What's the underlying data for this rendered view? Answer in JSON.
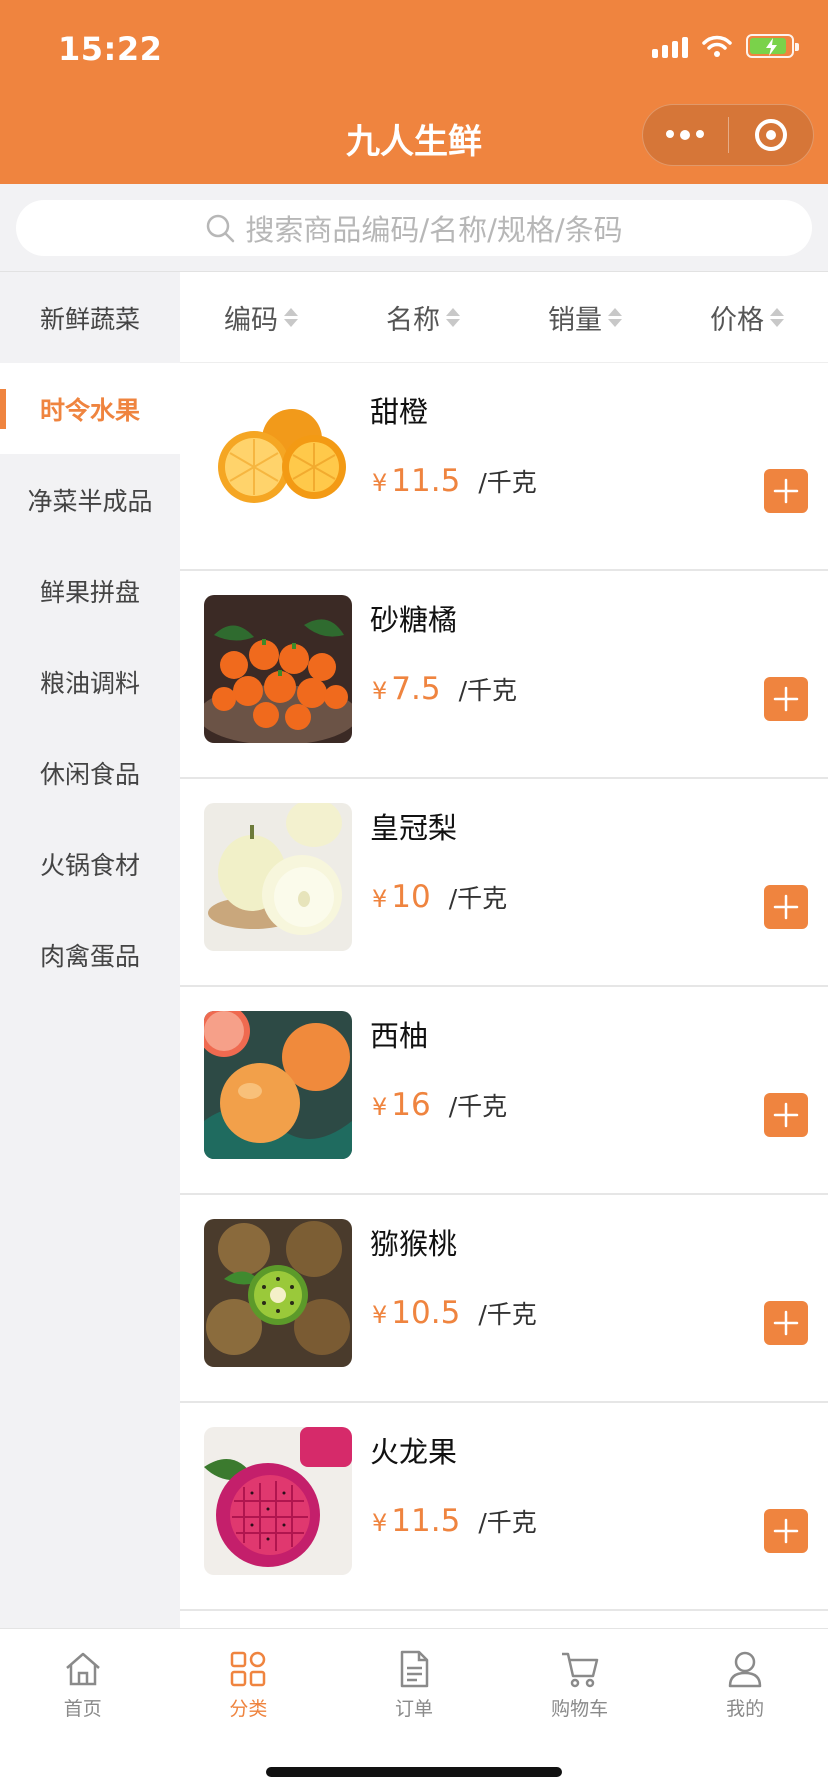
{
  "status_bar": {
    "time": "15:22"
  },
  "header": {
    "title": "九人生鲜"
  },
  "search": {
    "placeholder": "搜索商品编码/名称/规格/条码"
  },
  "sidebar": {
    "items": [
      {
        "label": "新鲜蔬菜",
        "active": false
      },
      {
        "label": "时令水果",
        "active": true
      },
      {
        "label": "净菜半成品",
        "active": false
      },
      {
        "label": "鲜果拼盘",
        "active": false
      },
      {
        "label": "粮油调料",
        "active": false
      },
      {
        "label": "休闲食品",
        "active": false
      },
      {
        "label": "火锅食材",
        "active": false
      },
      {
        "label": "肉禽蛋品",
        "active": false
      }
    ]
  },
  "sort": {
    "options": [
      {
        "label": "编码"
      },
      {
        "label": "名称"
      },
      {
        "label": "销量"
      },
      {
        "label": "价格"
      }
    ]
  },
  "products": [
    {
      "name": "甜橙",
      "currency": "¥",
      "price": "11.5",
      "unit": "/千克",
      "image": "orange"
    },
    {
      "name": "砂糖橘",
      "currency": "¥",
      "price": "7.5",
      "unit": "/千克",
      "image": "tangerine"
    },
    {
      "name": "皇冠梨",
      "currency": "¥",
      "price": "10",
      "unit": "/千克",
      "image": "pear"
    },
    {
      "name": "西柚",
      "currency": "¥",
      "price": "16",
      "unit": "/千克",
      "image": "grapefruit"
    },
    {
      "name": "猕猴桃",
      "currency": "¥",
      "price": "10.5",
      "unit": "/千克",
      "image": "kiwi"
    },
    {
      "name": "火龙果",
      "currency": "¥",
      "price": "11.5",
      "unit": "/千克",
      "image": "dragonfruit"
    }
  ],
  "tabbar": {
    "tabs": [
      {
        "label": "首页",
        "icon": "home-icon",
        "active": false
      },
      {
        "label": "分类",
        "icon": "category-icon",
        "active": true
      },
      {
        "label": "订单",
        "icon": "order-icon",
        "active": false
      },
      {
        "label": "购物车",
        "icon": "cart-icon",
        "active": false
      },
      {
        "label": "我的",
        "icon": "user-icon",
        "active": false
      }
    ]
  },
  "colors": {
    "accent": "#ef843f",
    "sidebar_bg": "#f2f2f4",
    "tab_inactive": "#8a8a8a"
  }
}
